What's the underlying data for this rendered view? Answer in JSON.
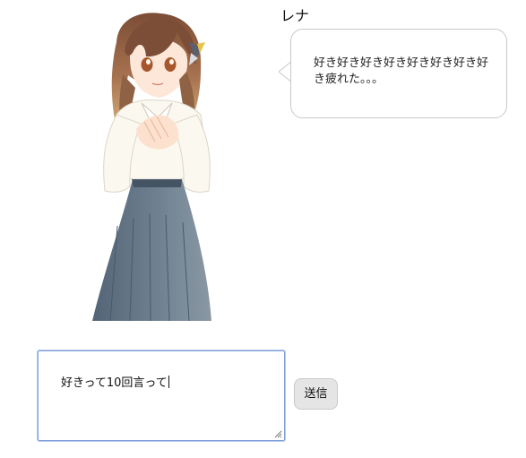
{
  "character": {
    "name": "レナ",
    "image_icon": "character-portrait-icon"
  },
  "bubble": {
    "text": "好き好き好き好き好き好き好き好き疲れた。。。"
  },
  "input": {
    "value": "好きって10回言って"
  },
  "buttons": {
    "send_label": "送信"
  },
  "colors": {
    "bubble_border": "#c8c8c8",
    "input_focus_border": "#7f9ed9",
    "send_button_bg": "#e5e5e5",
    "skirt": "#5b6d82",
    "hair": "#9b6a4c"
  }
}
